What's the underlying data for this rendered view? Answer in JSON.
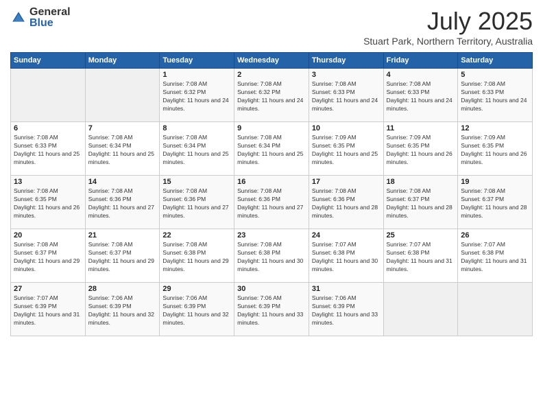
{
  "logo": {
    "general": "General",
    "blue": "Blue"
  },
  "title": "July 2025",
  "subtitle": "Stuart Park, Northern Territory, Australia",
  "weekdays": [
    "Sunday",
    "Monday",
    "Tuesday",
    "Wednesday",
    "Thursday",
    "Friday",
    "Saturday"
  ],
  "weeks": [
    [
      {
        "day": "",
        "detail": ""
      },
      {
        "day": "",
        "detail": ""
      },
      {
        "day": "1",
        "detail": "Sunrise: 7:08 AM\nSunset: 6:32 PM\nDaylight: 11 hours and 24 minutes."
      },
      {
        "day": "2",
        "detail": "Sunrise: 7:08 AM\nSunset: 6:32 PM\nDaylight: 11 hours and 24 minutes."
      },
      {
        "day": "3",
        "detail": "Sunrise: 7:08 AM\nSunset: 6:33 PM\nDaylight: 11 hours and 24 minutes."
      },
      {
        "day": "4",
        "detail": "Sunrise: 7:08 AM\nSunset: 6:33 PM\nDaylight: 11 hours and 24 minutes."
      },
      {
        "day": "5",
        "detail": "Sunrise: 7:08 AM\nSunset: 6:33 PM\nDaylight: 11 hours and 24 minutes."
      }
    ],
    [
      {
        "day": "6",
        "detail": "Sunrise: 7:08 AM\nSunset: 6:33 PM\nDaylight: 11 hours and 25 minutes."
      },
      {
        "day": "7",
        "detail": "Sunrise: 7:08 AM\nSunset: 6:34 PM\nDaylight: 11 hours and 25 minutes."
      },
      {
        "day": "8",
        "detail": "Sunrise: 7:08 AM\nSunset: 6:34 PM\nDaylight: 11 hours and 25 minutes."
      },
      {
        "day": "9",
        "detail": "Sunrise: 7:08 AM\nSunset: 6:34 PM\nDaylight: 11 hours and 25 minutes."
      },
      {
        "day": "10",
        "detail": "Sunrise: 7:09 AM\nSunset: 6:35 PM\nDaylight: 11 hours and 25 minutes."
      },
      {
        "day": "11",
        "detail": "Sunrise: 7:09 AM\nSunset: 6:35 PM\nDaylight: 11 hours and 26 minutes."
      },
      {
        "day": "12",
        "detail": "Sunrise: 7:09 AM\nSunset: 6:35 PM\nDaylight: 11 hours and 26 minutes."
      }
    ],
    [
      {
        "day": "13",
        "detail": "Sunrise: 7:08 AM\nSunset: 6:35 PM\nDaylight: 11 hours and 26 minutes."
      },
      {
        "day": "14",
        "detail": "Sunrise: 7:08 AM\nSunset: 6:36 PM\nDaylight: 11 hours and 27 minutes."
      },
      {
        "day": "15",
        "detail": "Sunrise: 7:08 AM\nSunset: 6:36 PM\nDaylight: 11 hours and 27 minutes."
      },
      {
        "day": "16",
        "detail": "Sunrise: 7:08 AM\nSunset: 6:36 PM\nDaylight: 11 hours and 27 minutes."
      },
      {
        "day": "17",
        "detail": "Sunrise: 7:08 AM\nSunset: 6:36 PM\nDaylight: 11 hours and 28 minutes."
      },
      {
        "day": "18",
        "detail": "Sunrise: 7:08 AM\nSunset: 6:37 PM\nDaylight: 11 hours and 28 minutes."
      },
      {
        "day": "19",
        "detail": "Sunrise: 7:08 AM\nSunset: 6:37 PM\nDaylight: 11 hours and 28 minutes."
      }
    ],
    [
      {
        "day": "20",
        "detail": "Sunrise: 7:08 AM\nSunset: 6:37 PM\nDaylight: 11 hours and 29 minutes."
      },
      {
        "day": "21",
        "detail": "Sunrise: 7:08 AM\nSunset: 6:37 PM\nDaylight: 11 hours and 29 minutes."
      },
      {
        "day": "22",
        "detail": "Sunrise: 7:08 AM\nSunset: 6:38 PM\nDaylight: 11 hours and 29 minutes."
      },
      {
        "day": "23",
        "detail": "Sunrise: 7:08 AM\nSunset: 6:38 PM\nDaylight: 11 hours and 30 minutes."
      },
      {
        "day": "24",
        "detail": "Sunrise: 7:07 AM\nSunset: 6:38 PM\nDaylight: 11 hours and 30 minutes."
      },
      {
        "day": "25",
        "detail": "Sunrise: 7:07 AM\nSunset: 6:38 PM\nDaylight: 11 hours and 31 minutes."
      },
      {
        "day": "26",
        "detail": "Sunrise: 7:07 AM\nSunset: 6:38 PM\nDaylight: 11 hours and 31 minutes."
      }
    ],
    [
      {
        "day": "27",
        "detail": "Sunrise: 7:07 AM\nSunset: 6:39 PM\nDaylight: 11 hours and 31 minutes."
      },
      {
        "day": "28",
        "detail": "Sunrise: 7:06 AM\nSunset: 6:39 PM\nDaylight: 11 hours and 32 minutes."
      },
      {
        "day": "29",
        "detail": "Sunrise: 7:06 AM\nSunset: 6:39 PM\nDaylight: 11 hours and 32 minutes."
      },
      {
        "day": "30",
        "detail": "Sunrise: 7:06 AM\nSunset: 6:39 PM\nDaylight: 11 hours and 33 minutes."
      },
      {
        "day": "31",
        "detail": "Sunrise: 7:06 AM\nSunset: 6:39 PM\nDaylight: 11 hours and 33 minutes."
      },
      {
        "day": "",
        "detail": ""
      },
      {
        "day": "",
        "detail": ""
      }
    ]
  ]
}
